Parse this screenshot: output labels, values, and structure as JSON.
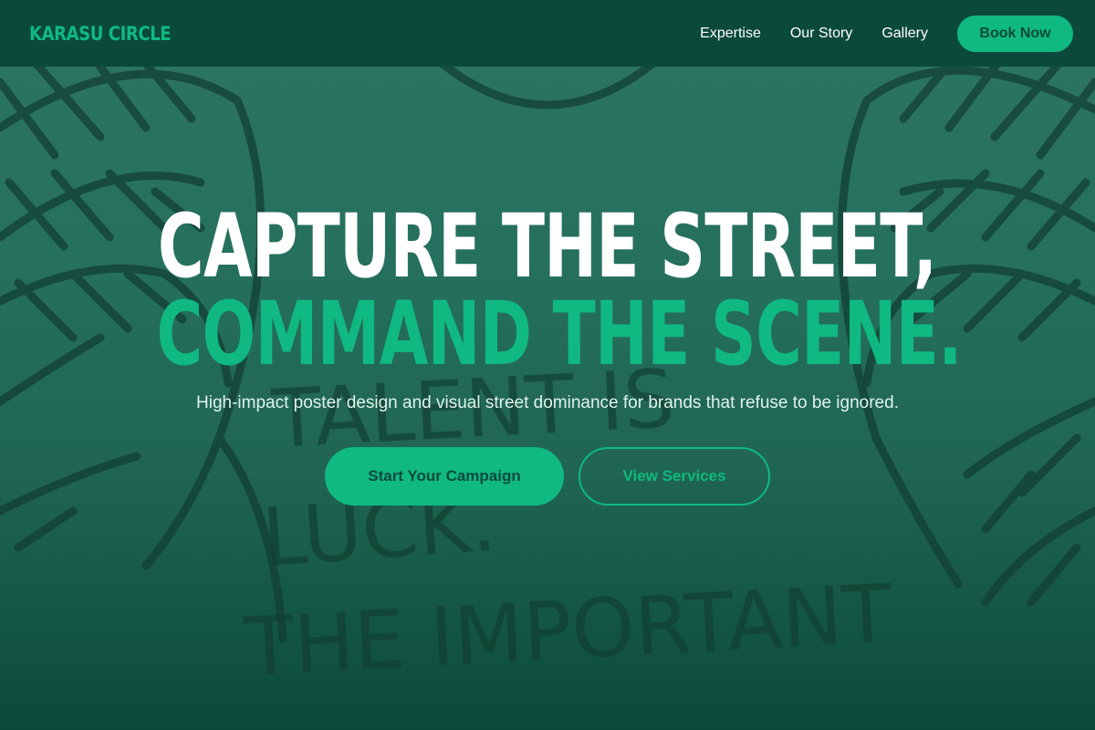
{
  "nav": {
    "logo": "KARASU CIRCLE",
    "links": [
      "Expertise",
      "Our Story",
      "Gallery"
    ],
    "book_label": "Book Now"
  },
  "hero": {
    "headline_line1": "CAPTURE THE STREET,",
    "headline_line2": "COMMAND THE SCENE.",
    "subtitle": "High-impact poster design and visual street dominance for brands that refuse to be ignored.",
    "primary_cta": "Start Your Campaign",
    "secondary_cta": "View Services",
    "background_text": [
      "TALENT IS",
      "LUCK.",
      "THE IMPORTANT"
    ]
  },
  "colors": {
    "accent": "#10b981",
    "nav_bg": "#0b4a3b",
    "hero_bg": "#26705e"
  }
}
